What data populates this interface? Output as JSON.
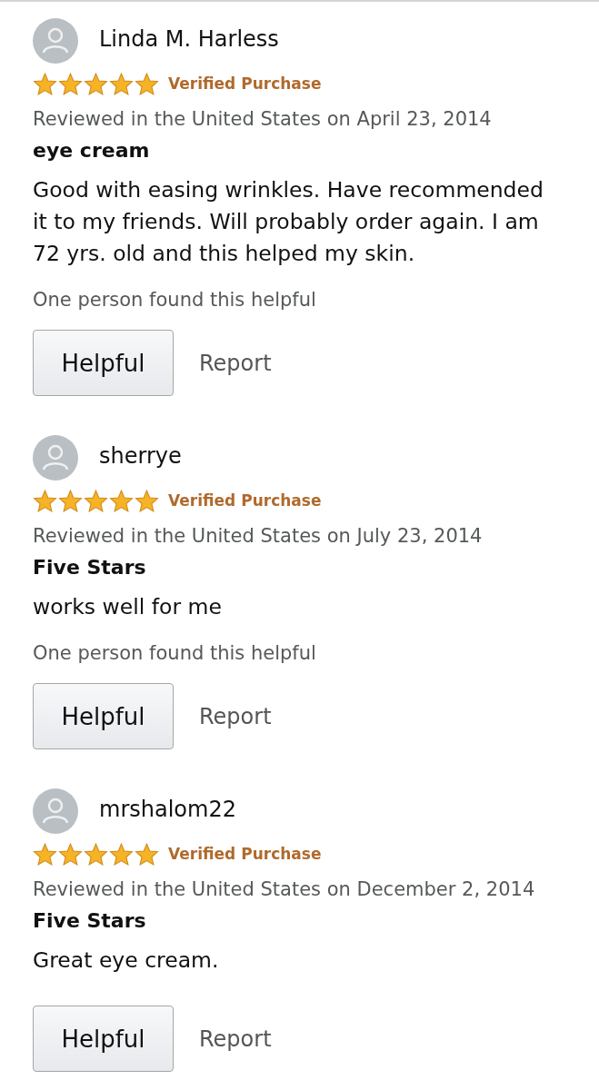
{
  "reviews": [
    {
      "author": "Linda M. Harless",
      "stars": 5,
      "badge": "Verified Purchase",
      "date": "Reviewed in the United States on April 23, 2014",
      "title": "eye cream",
      "body": "Good with easing wrinkles. Have recommended it to my friends. Will probably order again. I am 72 yrs. old and this helped my skin.",
      "helpful_count": "One person found this helpful",
      "helpful_button": "Helpful",
      "report": "Report"
    },
    {
      "author": "sherrye",
      "stars": 5,
      "badge": "Verified Purchase",
      "date": "Reviewed in the United States on July 23, 2014",
      "title": "Five Stars",
      "body": "works well for me",
      "helpful_count": "One person found this helpful",
      "helpful_button": "Helpful",
      "report": "Report"
    },
    {
      "author": "mrshalom22",
      "stars": 5,
      "badge": "Verified Purchase",
      "date": "Reviewed in the United States on December 2, 2014",
      "title": "Five Stars",
      "body": "Great eye cream.",
      "helpful_button": "Helpful",
      "report": "Report"
    }
  ]
}
